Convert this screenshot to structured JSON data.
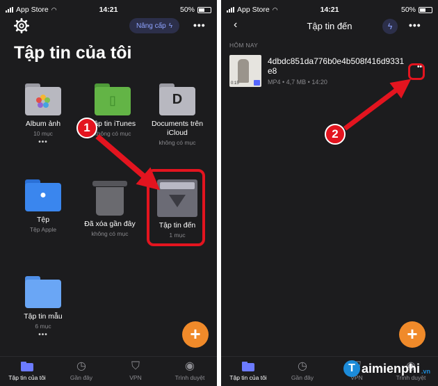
{
  "status_bar": {
    "carrier": "App Store",
    "time": "14:21",
    "battery": "50%"
  },
  "left_screen": {
    "upgrade_label": "Nâng cấp",
    "title": "Tập tin của tôi",
    "items": [
      {
        "title": "Album ảnh",
        "subtitle": "10 mục",
        "has_more": true
      },
      {
        "title": "Tập tin iTunes",
        "subtitle": "không có mục",
        "has_more": false
      },
      {
        "title": "Documents trên iCloud",
        "subtitle": "không có mục",
        "has_more": false
      },
      {
        "title": "Tệp",
        "subtitle": "Tệp Apple",
        "has_more": false
      },
      {
        "title": "Đã xóa gần đây",
        "subtitle": "không có mục",
        "has_more": false
      },
      {
        "title": "Tập tin đến",
        "subtitle": "1 mục",
        "has_more": false
      },
      {
        "title": "Tập tin mẫu",
        "subtitle": "6 mục",
        "has_more": true
      }
    ],
    "more_dots": "•••",
    "fab": "+"
  },
  "right_screen": {
    "title": "Tập tin đến",
    "section": "HÔM NAY",
    "file": {
      "name": "4dbdc851da776b0e4b508f416d9331e8",
      "meta": "MP4 • 4,7 MB • 14:20",
      "duration": "0:15"
    },
    "fab": "+"
  },
  "tab_bar": {
    "tabs": [
      {
        "label": "Tập tin của tôi",
        "icon": "folder-icon"
      },
      {
        "label": "Gần đây",
        "icon": "clock-icon"
      },
      {
        "label": "VPN",
        "icon": "shield-bolt-icon"
      },
      {
        "label": "Trình duyệt",
        "icon": "compass-icon"
      }
    ]
  },
  "annotations": {
    "step1": "1",
    "step2": "2"
  },
  "watermark": {
    "text": "aimienphi",
    "tld": ".vn"
  },
  "colors": {
    "background": "#1c1c1e",
    "accent": "#6c7bff",
    "fab": "#f08a2a",
    "annotation": "#e3141f"
  }
}
